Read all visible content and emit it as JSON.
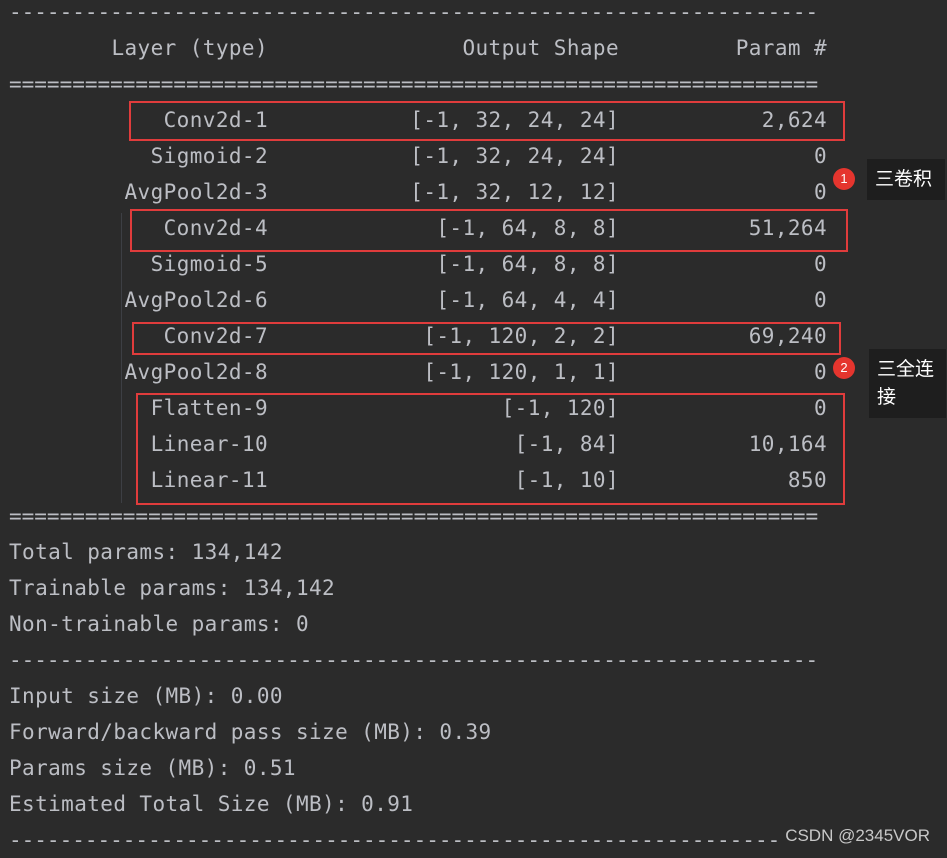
{
  "header": {
    "layer_col": "Layer (type)",
    "shape_col": "Output Shape",
    "param_col": "Param #"
  },
  "separators": {
    "dash": "----------------------------------------------------------------",
    "equals": "================================================================"
  },
  "rows": [
    {
      "layer": "Conv2d-1",
      "shape": "[-1, 32, 24, 24]",
      "param": "2,624"
    },
    {
      "layer": "Sigmoid-2",
      "shape": "[-1, 32, 24, 24]",
      "param": "0"
    },
    {
      "layer": "AvgPool2d-3",
      "shape": "[-1, 32, 12, 12]",
      "param": "0"
    },
    {
      "layer": "Conv2d-4",
      "shape": "[-1, 64, 8, 8]",
      "param": "51,264"
    },
    {
      "layer": "Sigmoid-5",
      "shape": "[-1, 64, 8, 8]",
      "param": "0"
    },
    {
      "layer": "AvgPool2d-6",
      "shape": "[-1, 64, 4, 4]",
      "param": "0"
    },
    {
      "layer": "Conv2d-7",
      "shape": "[-1, 120, 2, 2]",
      "param": "69,240"
    },
    {
      "layer": "AvgPool2d-8",
      "shape": "[-1, 120, 1, 1]",
      "param": "0"
    },
    {
      "layer": "Flatten-9",
      "shape": "[-1, 120]",
      "param": "0"
    },
    {
      "layer": "Linear-10",
      "shape": "[-1, 84]",
      "param": "10,164"
    },
    {
      "layer": "Linear-11",
      "shape": "[-1, 10]",
      "param": "850"
    }
  ],
  "summary": {
    "total_params": "Total params: 134,142",
    "trainable_params": "Trainable params: 134,142",
    "non_trainable_params": "Non-trainable params: 0",
    "input_size": "Input size (MB): 0.00",
    "forward_backward_size": "Forward/backward pass size (MB): 0.39",
    "params_size": "Params size (MB): 0.51",
    "estimated_total": "Estimated Total Size (MB): 0.91"
  },
  "annotations": {
    "badge_1": "1",
    "badge_2": "2",
    "note_1": "三卷积",
    "note_2_line1": "三全连",
    "note_2_line2": "接",
    "highlight_color": "#e03c3c",
    "badge_color": "#e5352e"
  },
  "watermark": "CSDN @2345VOR"
}
